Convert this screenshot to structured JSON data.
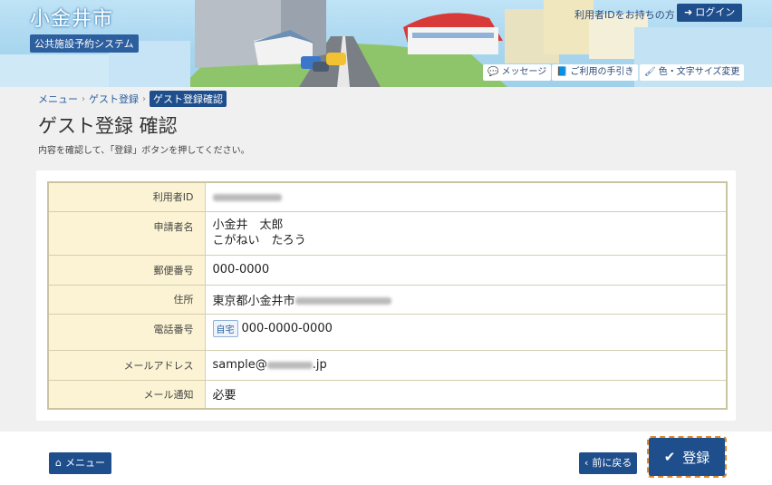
{
  "header": {
    "city_name": "小金井市",
    "system_name": "公共施設予約システム",
    "login_hint": "利用者IDをお持ちの方",
    "login_label": "ログイン",
    "tools": {
      "message": "メッセージ",
      "guide": "ご利用の手引き",
      "display": "色・文字サイズ変更"
    }
  },
  "breadcrumb": {
    "menu": "メニュー",
    "guest": "ゲスト登録",
    "current": "ゲスト登録確認"
  },
  "page": {
    "title": "ゲスト登録 確認",
    "description": "内容を確認して、「登録」ボタンを押してください。"
  },
  "form": {
    "user_id": {
      "label": "利用者ID"
    },
    "applicant": {
      "label": "申請者名",
      "name": "小金井　太郎",
      "kana": "こがねい　たろう"
    },
    "postal": {
      "label": "郵便番号",
      "value": "000-0000"
    },
    "address": {
      "label": "住所",
      "value": "東京都小金井市"
    },
    "phone": {
      "label": "電話番号",
      "tag": "自宅",
      "value": "000-0000-0000"
    },
    "email": {
      "label": "メールアドレス",
      "prefix": "sample@",
      "suffix": ".jp"
    },
    "notify": {
      "label": "メール通知",
      "value": "必要"
    }
  },
  "footer": {
    "menu_label": "メニュー",
    "back_label": "前に戻る",
    "register_label": "登録"
  },
  "colors": {
    "primary": "#1f4e8c",
    "label_bg": "#fbf3d3",
    "focus_outline": "#e08a2a"
  }
}
